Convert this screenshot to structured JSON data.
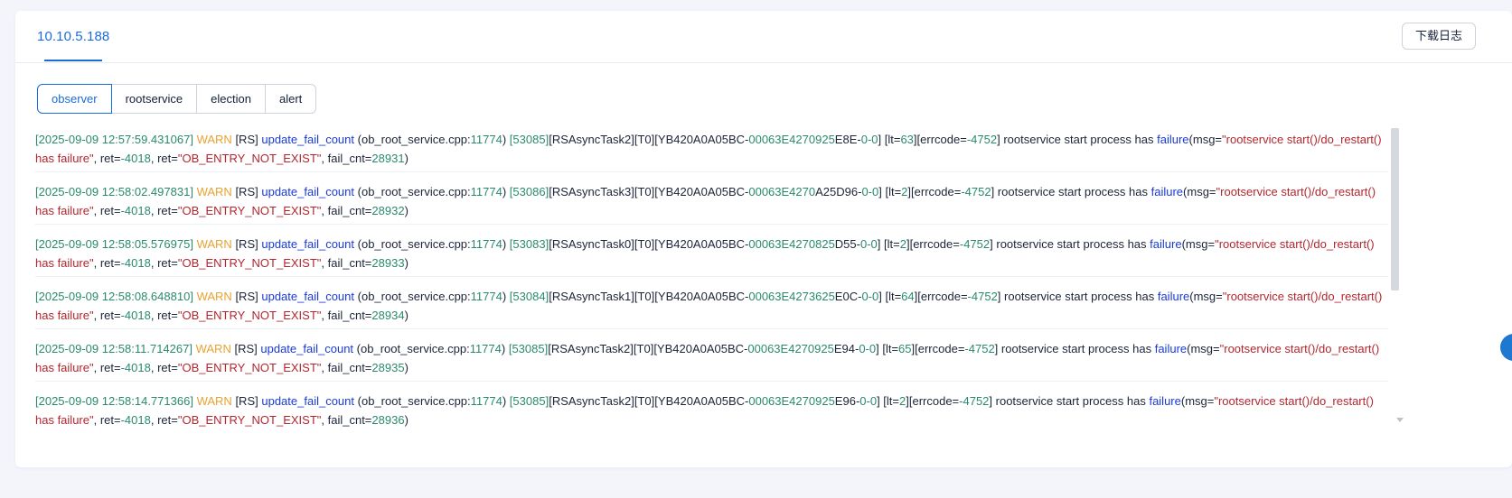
{
  "header": {
    "host_tab": "10.10.5.188",
    "download_label": "下载日志"
  },
  "log_tabs": [
    {
      "label": "observer",
      "active": true
    },
    {
      "label": "rootservice",
      "active": false
    },
    {
      "label": "election",
      "active": false
    },
    {
      "label": "alert",
      "active": false
    }
  ],
  "logs": [
    {
      "ts": "[2025-09-09 12:57:59.431067]",
      "tid": "53085",
      "thread": "RSAsyncTask2",
      "trace_mid": "E4270925",
      "trace_end": "E8E",
      "lt": "63",
      "retry": "28931"
    },
    {
      "ts": "[2025-09-09 12:58:02.497831]",
      "tid": "53086",
      "thread": "RSAsyncTask3",
      "trace_mid": "E4270",
      "trace_end": "A25D96",
      "lt": "2",
      "retry": "28932"
    },
    {
      "ts": "[2025-09-09 12:58:05.576975]",
      "tid": "53083",
      "thread": "RSAsyncTask0",
      "trace_mid": "E4270825",
      "trace_end": "D55",
      "lt": "2",
      "retry": "28933"
    },
    {
      "ts": "[2025-09-09 12:58:08.648810]",
      "tid": "53084",
      "thread": "RSAsyncTask1",
      "trace_mid": "E4273625",
      "trace_end": "E0C",
      "lt": "64",
      "retry": "28934"
    },
    {
      "ts": "[2025-09-09 12:58:11.714267]",
      "tid": "53085",
      "thread": "RSAsyncTask2",
      "trace_mid": "E4270925",
      "trace_end": "E94",
      "lt": "65",
      "retry": "28935"
    },
    {
      "ts": "[2025-09-09 12:58:14.771366]",
      "tid": "53085",
      "thread": "RSAsyncTask2",
      "trace_mid": "E4270925",
      "trace_end": "E96",
      "lt": "2",
      "retry": "28936"
    }
  ],
  "log_common": {
    "level": "WARN",
    "module": "[RS]",
    "func": "update_fail_count",
    "src_file": "(ob_root_service.cpp:",
    "src_line": "11774",
    "tenant": "[T0]",
    "trace_prefix": "[YB420A0A05BC-",
    "trace_num": "00063",
    "trace_tail": "0-0",
    "errcode": "-4752",
    "message": "rootservice start process has",
    "failure": "failure",
    "msg_str": "\"rootservice start()/do_restart() has failure\"",
    "ret_num": "-4018",
    "ret_str": "\"OB_ENTRY_NOT_EXIST\""
  },
  "colors": {
    "accent": "#1a6cdc",
    "timestamp": "#2a8a6e",
    "warn": "#e8a232",
    "function": "#1a3ad8",
    "string": "#b3262e"
  }
}
